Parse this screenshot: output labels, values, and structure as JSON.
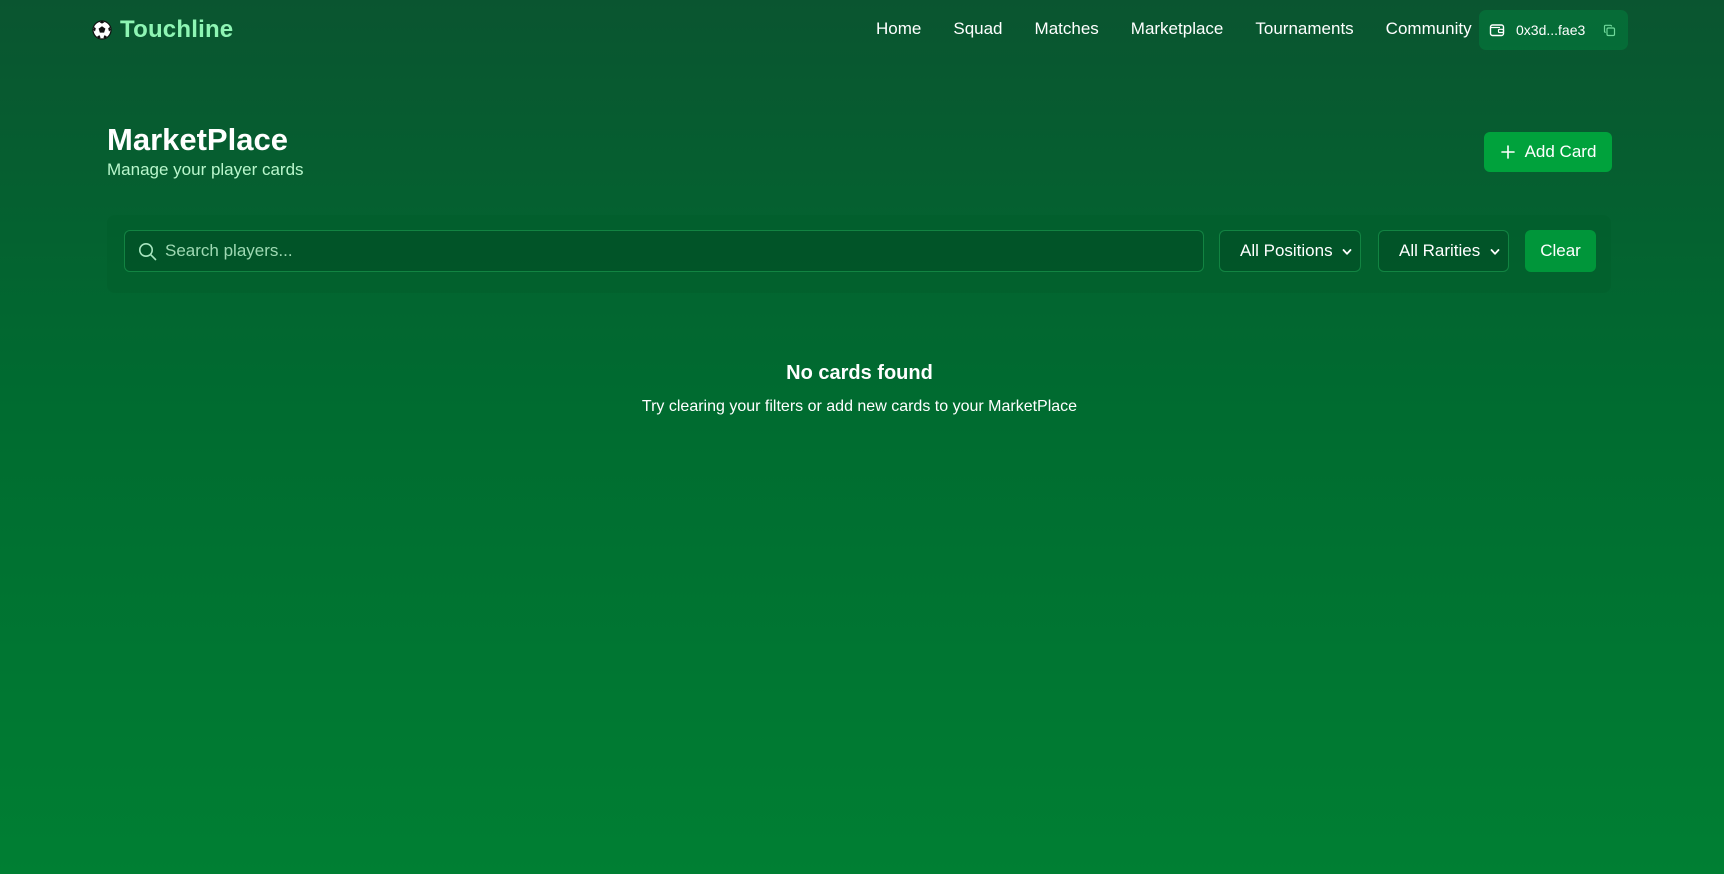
{
  "header": {
    "brand_name": "Touchline",
    "brand_icon": "soccer-ball-icon",
    "nav": [
      {
        "label": "Home"
      },
      {
        "label": "Squad"
      },
      {
        "label": "Matches"
      },
      {
        "label": "Marketplace"
      },
      {
        "label": "Tournaments"
      },
      {
        "label": "Community"
      }
    ],
    "wallet": {
      "icon": "wallet-icon",
      "address": "0x3d...fae3",
      "copy_icon": "copy-icon"
    }
  },
  "page": {
    "title": "MarketPlace",
    "subtitle": "Manage your player cards",
    "add_button_label": "Add Card",
    "add_button_icon": "plus-icon"
  },
  "filters": {
    "search_placeholder": "Search players...",
    "search_value": "",
    "search_icon": "search-icon",
    "position_selected": "All Positions",
    "rarity_selected": "All Rarities",
    "clear_label": "Clear"
  },
  "empty_state": {
    "title": "No cards found",
    "message": "Try clearing your filters or add new cards to your MarketPlace"
  },
  "colors": {
    "background_top": "#0a5530",
    "background_bottom": "#007f33",
    "brand_text": "#8ef5b4",
    "primary_button": "#00a23c",
    "subtitle_text": "#b9f6cc"
  }
}
